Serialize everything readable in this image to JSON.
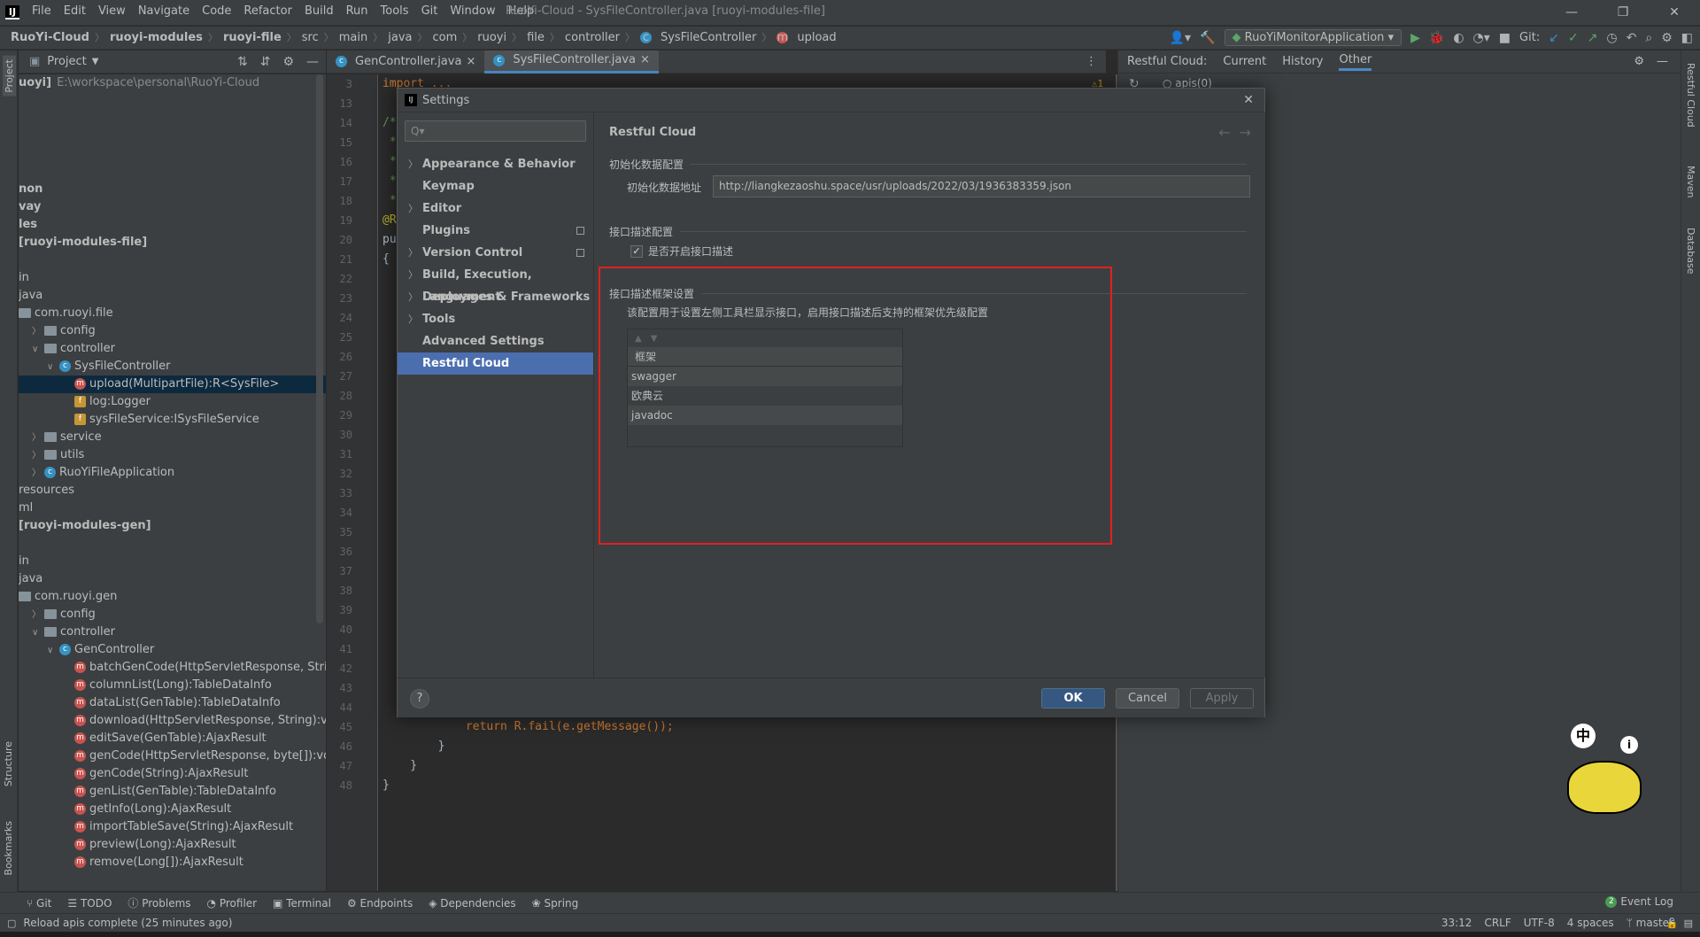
{
  "titlebar": {
    "menu": [
      "File",
      "Edit",
      "View",
      "Navigate",
      "Code",
      "Refactor",
      "Build",
      "Run",
      "Tools",
      "Git",
      "Window",
      "Help"
    ],
    "title": "RuoYi-Cloud - SysFileController.java [ruoyi-modules-file]"
  },
  "breadcrumb": [
    "RuoYi-Cloud",
    "ruoyi-modules",
    "ruoyi-file",
    "src",
    "main",
    "java",
    "com",
    "ruoyi",
    "file",
    "controller",
    "SysFileController",
    "upload"
  ],
  "toolbar": {
    "run_config": "RuoYiMonitorApplication",
    "git_label": "Git:"
  },
  "leftstrip": {
    "project": "Project",
    "structure": "Structure",
    "bookmarks": "Bookmarks"
  },
  "rightstrip": {
    "restful": "Restful Cloud",
    "maven": "Maven",
    "database": "Database"
  },
  "project": {
    "title": "Project",
    "rows": [
      {
        "text": "uoyi]",
        "extra": "E:\\workspace\\personal\\RuoYi-Cloud",
        "indent": 0,
        "icon": "",
        "bold": true
      },
      {
        "text": "",
        "indent": 0,
        "icon": ""
      },
      {
        "text": "",
        "indent": 0,
        "icon": ""
      },
      {
        "text": "",
        "indent": 0,
        "icon": ""
      },
      {
        "text": "",
        "indent": 0,
        "icon": ""
      },
      {
        "text": "",
        "indent": 0,
        "icon": ""
      },
      {
        "text": "non",
        "indent": 0,
        "icon": "",
        "bold": true
      },
      {
        "text": "vay",
        "indent": 0,
        "icon": "",
        "bold": true
      },
      {
        "text": "les",
        "indent": 0,
        "icon": "",
        "bold": true
      },
      {
        "text": " [ruoyi-modules-file]",
        "indent": 0,
        "icon": "",
        "bold": true
      },
      {
        "text": "",
        "indent": 0,
        "icon": ""
      },
      {
        "text": "in",
        "indent": 0,
        "icon": ""
      },
      {
        "text": "java",
        "indent": 0,
        "icon": ""
      },
      {
        "text": "com.ruoyi.file",
        "indent": 0,
        "icon": "folder"
      },
      {
        "text": "config",
        "indent": 1,
        "icon": "folder",
        "arrow": ">"
      },
      {
        "text": "controller",
        "indent": 1,
        "icon": "folder",
        "arrow": "v"
      },
      {
        "text": "SysFileController",
        "indent": 2,
        "icon": "c",
        "arrow": "v"
      },
      {
        "text": "upload(MultipartFile):R<SysFile>",
        "indent": 3,
        "icon": "m",
        "selected": true
      },
      {
        "text": "log:Logger",
        "indent": 3,
        "icon": "f"
      },
      {
        "text": "sysFileService:ISysFileService",
        "indent": 3,
        "icon": "f"
      },
      {
        "text": "service",
        "indent": 1,
        "icon": "folder",
        "arrow": ">"
      },
      {
        "text": "utils",
        "indent": 1,
        "icon": "folder",
        "arrow": ">"
      },
      {
        "text": "RuoYiFileApplication",
        "indent": 1,
        "icon": "c",
        "arrow": ">"
      },
      {
        "text": "resources",
        "indent": 0,
        "icon": ""
      },
      {
        "text": "ml",
        "indent": 0,
        "icon": ""
      },
      {
        "text": " [ruoyi-modules-gen]",
        "indent": 0,
        "icon": "",
        "bold": true
      },
      {
        "text": "",
        "indent": 0,
        "icon": ""
      },
      {
        "text": "in",
        "indent": 0,
        "icon": ""
      },
      {
        "text": "java",
        "indent": 0,
        "icon": ""
      },
      {
        "text": "com.ruoyi.gen",
        "indent": 0,
        "icon": "folder"
      },
      {
        "text": "config",
        "indent": 1,
        "icon": "folder",
        "arrow": ">"
      },
      {
        "text": "controller",
        "indent": 1,
        "icon": "folder",
        "arrow": "v"
      },
      {
        "text": "GenController",
        "indent": 2,
        "icon": "c",
        "arrow": "v"
      },
      {
        "text": "batchGenCode(HttpServletResponse, String):vo",
        "indent": 3,
        "icon": "m"
      },
      {
        "text": "columnList(Long):TableDataInfo",
        "indent": 3,
        "icon": "m"
      },
      {
        "text": "dataList(GenTable):TableDataInfo",
        "indent": 3,
        "icon": "m"
      },
      {
        "text": "download(HttpServletResponse, String):void",
        "indent": 3,
        "icon": "m"
      },
      {
        "text": "editSave(GenTable):AjaxResult",
        "indent": 3,
        "icon": "m"
      },
      {
        "text": "genCode(HttpServletResponse, byte[]):void",
        "indent": 3,
        "icon": "m"
      },
      {
        "text": "genCode(String):AjaxResult",
        "indent": 3,
        "icon": "m"
      },
      {
        "text": "genList(GenTable):TableDataInfo",
        "indent": 3,
        "icon": "m"
      },
      {
        "text": "getInfo(Long):AjaxResult",
        "indent": 3,
        "icon": "m"
      },
      {
        "text": "importTableSave(String):AjaxResult",
        "indent": 3,
        "icon": "m"
      },
      {
        "text": "preview(Long):AjaxResult",
        "indent": 3,
        "icon": "m"
      },
      {
        "text": "remove(Long[]):AjaxResult",
        "indent": 3,
        "icon": "m"
      }
    ]
  },
  "editor": {
    "tabs": [
      {
        "label": "GenController.java",
        "active": false
      },
      {
        "label": "SysFileController.java",
        "active": true
      }
    ],
    "lines": [
      "3",
      "13",
      "14",
      "15",
      "16",
      "17",
      "18",
      "19",
      "20",
      "21",
      "22",
      "23",
      "24",
      "25",
      "26",
      "27",
      "28",
      "29",
      "30",
      "31",
      "32",
      "33",
      "34",
      "35",
      "36",
      "37",
      "38",
      "39",
      "40",
      "41",
      "42",
      "43",
      "44",
      "45",
      "46",
      "47",
      "48"
    ],
    "code_top": [
      {
        "line": "3",
        "text": "import ..."
      },
      {
        "line": "14",
        "text": "/*"
      },
      {
        "line": "15",
        "text": " *"
      },
      {
        "line": "16",
        "text": " *"
      },
      {
        "line": "17",
        "text": " *"
      },
      {
        "line": "18",
        "text": " *"
      },
      {
        "line": "19",
        "text": "@R"
      },
      {
        "line": "20",
        "text": "pu"
      },
      {
        "line": "21",
        "text": "{"
      }
    ],
    "code_bottom": [
      {
        "line": "45",
        "text": "            return R.fail(e.getMessage());"
      },
      {
        "line": "46",
        "text": "        }"
      },
      {
        "line": "47",
        "text": "    }"
      },
      {
        "line": "48",
        "text": "}"
      }
    ],
    "inspection": "⚠1"
  },
  "restful": {
    "title": "Restful Cloud:",
    "tabs": [
      "Current",
      "History",
      "Other"
    ],
    "active_tab": "Other",
    "tree_item": "apis(0)"
  },
  "dialog": {
    "title": "Settings",
    "search_placeholder": "Q▾",
    "nav": [
      {
        "label": "Appearance & Behavior",
        "arrow": true
      },
      {
        "label": "Keymap",
        "arrow": false
      },
      {
        "label": "Editor",
        "arrow": true
      },
      {
        "label": "Plugins",
        "arrow": false,
        "pin": true
      },
      {
        "label": "Version Control",
        "arrow": true,
        "pin": true
      },
      {
        "label": "Build, Execution, Deployment",
        "arrow": true
      },
      {
        "label": "Languages & Frameworks",
        "arrow": true
      },
      {
        "label": "Tools",
        "arrow": true
      },
      {
        "label": "Advanced Settings",
        "arrow": false
      },
      {
        "label": "Restful Cloud",
        "arrow": false,
        "selected": true
      }
    ],
    "page_title": "Restful Cloud",
    "init_group": "初始化数据配置",
    "init_label": "初始化数据地址",
    "init_url": "http://liangkezaoshu.space/usr/uploads/2022/03/1936383359.json",
    "desc_group": "接口描述配置",
    "desc_checkbox": "是否开启接口描述",
    "desc_checked": true,
    "fw_group": "接口描述框架设置",
    "fw_hint": "该配置用于设置左侧工具栏显示接口，启用接口描述后支持的框架优先级配置",
    "fw_header": "框架",
    "frameworks": [
      "swagger",
      "欧典云",
      "javadoc"
    ],
    "help": "?",
    "ok": "OK",
    "cancel": "Cancel",
    "apply": "Apply",
    "highlight_color": "#e02020"
  },
  "toolwindows": [
    "Git",
    "TODO",
    "Problems",
    "Profiler",
    "Terminal",
    "Endpoints",
    "Dependencies",
    "Spring"
  ],
  "eventlog": {
    "count": "2",
    "label": "Event Log"
  },
  "status": {
    "message": "Reload apis complete (25 minutes ago)",
    "position": "33:12",
    "line_sep": "CRLF",
    "encoding": "UTF-8",
    "indent": "4 spaces",
    "branch": "master"
  },
  "ime": {
    "char": "中"
  }
}
